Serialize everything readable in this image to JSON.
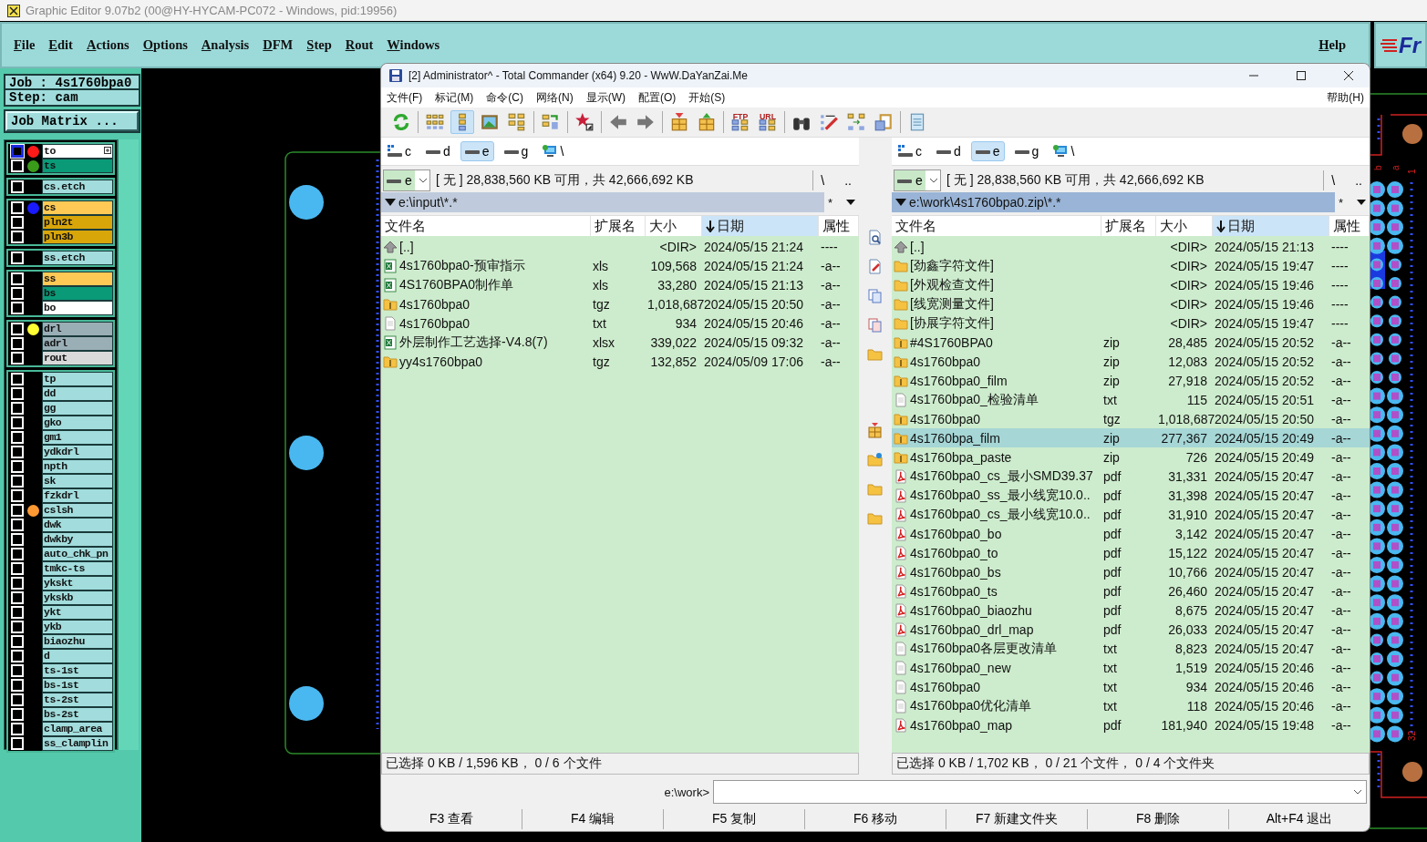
{
  "editor": {
    "title": "Graphic Editor 9.07b2 (00@HY-HYCAM-PC072 - Windows, pid:19956)",
    "menu": [
      "File",
      "Edit",
      "Actions",
      "Options",
      "Analysis",
      "DFM",
      "Step",
      "Rout",
      "Windows"
    ],
    "help": "Help",
    "logo_text": "Fr",
    "job": "Job : 4s1760bpa0",
    "step": "Step: cam",
    "job_matrix": "Job Matrix ...",
    "layer_groups": [
      {
        "layers": [
          {
            "name": "to",
            "color": "#ffffff",
            "marker": {
              "color": "#ff1a1a"
            },
            "selected": true
          },
          {
            "name": "ts",
            "color": "#0a9a78",
            "marker": {
              "color": "#3a9a1a"
            },
            "selected": false
          }
        ]
      },
      {
        "layers": [
          {
            "name": "cs.etch",
            "color": "#a2dcdc",
            "selected": false
          }
        ]
      },
      {
        "layers": [
          {
            "name": "cs",
            "color": "#ffc955",
            "marker": {
              "color": "#1a1aff"
            },
            "selected": false
          },
          {
            "name": "pln2t",
            "color": "#d9a60a",
            "selected": false
          },
          {
            "name": "pln3b",
            "color": "#d9a60a",
            "selected": false
          }
        ]
      },
      {
        "layers": [
          {
            "name": "ss.etch",
            "color": "#a2dcdc",
            "selected": false
          }
        ]
      },
      {
        "layers": [
          {
            "name": "ss",
            "color": "#ffc955",
            "selected": false
          },
          {
            "name": "bs",
            "color": "#0a9a78",
            "selected": false
          },
          {
            "name": "bo",
            "color": "#ffffff",
            "selected": false
          }
        ]
      },
      {
        "layers": [
          {
            "name": "drl",
            "color": "#9aaeb6",
            "marker": {
              "color": "#ffff33"
            },
            "selected": false
          },
          {
            "name": "adrl",
            "color": "#9aaeb6",
            "selected": false
          },
          {
            "name": "rout",
            "color": "#d9d9d9",
            "selected": false
          }
        ]
      },
      {
        "layers": [
          {
            "name": "tp",
            "color": "#a2dcdc",
            "selected": false
          },
          {
            "name": "dd",
            "color": "#a2dcdc",
            "selected": false
          },
          {
            "name": "gg",
            "color": "#a2dcdc",
            "selected": false
          },
          {
            "name": "gko",
            "color": "#a2dcdc",
            "selected": false
          },
          {
            "name": "gm1",
            "color": "#a2dcdc",
            "selected": false
          },
          {
            "name": "ydkdrl",
            "color": "#a2dcdc",
            "selected": false
          },
          {
            "name": "npth",
            "color": "#a2dcdc",
            "selected": false
          },
          {
            "name": "sk",
            "color": "#a2dcdc",
            "selected": false
          },
          {
            "name": "fzkdrl",
            "color": "#a2dcdc",
            "selected": false
          },
          {
            "name": "cslsh",
            "color": "#a2dcdc",
            "marker": {
              "color": "#ff9933"
            },
            "selected": false
          },
          {
            "name": "dwk",
            "color": "#a2dcdc",
            "selected": false
          },
          {
            "name": "dwkby",
            "color": "#a2dcdc",
            "selected": false
          },
          {
            "name": "auto_chk_pn",
            "color": "#a2dcdc",
            "selected": false
          },
          {
            "name": "tmkc-ts",
            "color": "#a2dcdc",
            "selected": false
          },
          {
            "name": "ykskt",
            "color": "#a2dcdc",
            "selected": false
          },
          {
            "name": "ykskb",
            "color": "#a2dcdc",
            "selected": false
          },
          {
            "name": "ykt",
            "color": "#a2dcdc",
            "selected": false
          },
          {
            "name": "ykb",
            "color": "#a2dcdc",
            "selected": false
          },
          {
            "name": "biaozhu",
            "color": "#a2dcdc",
            "selected": false
          },
          {
            "name": "d",
            "color": "#a2dcdc",
            "selected": false
          },
          {
            "name": "ts-1st",
            "color": "#a2dcdc",
            "selected": false
          },
          {
            "name": "bs-1st",
            "color": "#a2dcdc",
            "selected": false
          },
          {
            "name": "ts-2st",
            "color": "#a2dcdc",
            "selected": false
          },
          {
            "name": "bs-2st",
            "color": "#a2dcdc",
            "selected": false
          },
          {
            "name": "clamp_area",
            "color": "#a2dcdc",
            "selected": false
          },
          {
            "name": "ss_clamplin",
            "color": "#a2dcdc",
            "selected": false
          }
        ]
      }
    ],
    "pin_labels": [
      "b",
      "a",
      "1",
      "32"
    ]
  },
  "commander": {
    "title": "[2] Administrator^ - Total Commander (x64) 9.20 - WwW.DaYanZai.Me",
    "menu": [
      "文件(F)",
      "标记(M)",
      "命令(C)",
      "网络(N)",
      "显示(W)",
      "配置(O)",
      "开始(S)"
    ],
    "help": "帮助(H)",
    "toolbar": [
      [
        {
          "kind": "refresh",
          "selected": false
        }
      ],
      [
        {
          "kind": "brief",
          "selected": false
        },
        {
          "kind": "tree",
          "selected": true
        },
        {
          "kind": "thumbs",
          "selected": false
        },
        {
          "kind": "branch",
          "selected": false
        }
      ],
      [
        {
          "kind": "compare",
          "selected": false
        }
      ],
      [
        {
          "kind": "star",
          "selected": false
        }
      ],
      [
        {
          "kind": "back",
          "selected": false
        },
        {
          "kind": "forward",
          "selected": false
        }
      ],
      [
        {
          "kind": "pack",
          "selected": false
        },
        {
          "kind": "unpack",
          "selected": false
        }
      ],
      [
        {
          "kind": "ftp",
          "label": "FTP",
          "selected": false
        },
        {
          "kind": "url",
          "label": "URL",
          "selected": false
        }
      ],
      [
        {
          "kind": "find",
          "selected": false
        },
        {
          "kind": "rename",
          "selected": false
        },
        {
          "kind": "sync",
          "selected": false
        },
        {
          "kind": "copynames",
          "selected": false
        }
      ],
      [
        {
          "kind": "notepad",
          "selected": false
        }
      ]
    ],
    "panels": [
      {
        "active": false,
        "drives": [
          {
            "label": "c",
            "kind": "system",
            "selected": false
          },
          {
            "label": "d",
            "kind": "disk",
            "selected": false
          },
          {
            "label": "e",
            "kind": "disk",
            "selected": true
          },
          {
            "label": "g",
            "kind": "disk",
            "selected": false
          },
          {
            "label": "\\",
            "kind": "network",
            "selected": false
          }
        ],
        "drive_combo": "e",
        "free_space": "[ 无 ]  28,838,560 KB 可用，共 42,666,692 KB",
        "root": "\\",
        "parent": "..",
        "path": "e:\\input\\*.*",
        "filter": "*",
        "columns": [
          {
            "label": "文件名",
            "sorted": false
          },
          {
            "label": "扩展名",
            "sorted": false
          },
          {
            "label": "大小",
            "sorted": false
          },
          {
            "label": "日期",
            "sorted": true
          },
          {
            "label": "属性",
            "sorted": false
          }
        ],
        "rows": [
          {
            "kind": "up",
            "name": "[..]",
            "size": "<DIR>",
            "date": "2024/05/15 21:24",
            "attr": "----",
            "selected": false
          },
          {
            "kind": "sheet",
            "name": "4s1760bpa0-预审指示",
            "ext": "xls",
            "size": "109,568",
            "date": "2024/05/15 21:24",
            "attr": "-a--",
            "selected": false
          },
          {
            "kind": "sheet",
            "name": "4S1760BPA0制作单",
            "ext": "xls",
            "size": "33,280",
            "date": "2024/05/15 21:13",
            "attr": "-a--",
            "selected": false
          },
          {
            "kind": "archive",
            "name": "4s1760bpa0",
            "ext": "tgz",
            "size": "1,018,687",
            "date": "2024/05/15 20:50",
            "attr": "-a--",
            "selected": false
          },
          {
            "kind": "text",
            "name": "4s1760bpa0",
            "ext": "txt",
            "size": "934",
            "date": "2024/05/15 20:46",
            "attr": "-a--",
            "selected": false
          },
          {
            "kind": "sheet",
            "name": "外层制作工艺选择-V4.8(7)",
            "ext": "xlsx",
            "size": "339,022",
            "date": "2024/05/15 09:32",
            "attr": "-a--",
            "selected": false
          },
          {
            "kind": "archive",
            "name": "yy4s1760bpa0",
            "ext": "tgz",
            "size": "132,852",
            "date": "2024/05/09 17:06",
            "attr": "-a--",
            "selected": false
          }
        ],
        "status": "已选择 0 KB / 1,596 KB， 0 / 6 个文件"
      },
      {
        "active": true,
        "drives": [
          {
            "label": "c",
            "kind": "system",
            "selected": false
          },
          {
            "label": "d",
            "kind": "disk",
            "selected": false
          },
          {
            "label": "e",
            "kind": "disk",
            "selected": true
          },
          {
            "label": "g",
            "kind": "disk",
            "selected": false
          },
          {
            "label": "\\",
            "kind": "network",
            "selected": false
          }
        ],
        "drive_combo": "e",
        "free_space": "[ 无 ]  28,838,560 KB 可用，共 42,666,692 KB",
        "root": "\\",
        "parent": "..",
        "path": "e:\\work\\4s1760bpa0.zip\\*.*",
        "filter": "*",
        "columns": [
          {
            "label": "文件名",
            "sorted": false
          },
          {
            "label": "扩展名",
            "sorted": false
          },
          {
            "label": "大小",
            "sorted": false
          },
          {
            "label": "日期",
            "sorted": true
          },
          {
            "label": "属性",
            "sorted": false
          }
        ],
        "rows": [
          {
            "kind": "up",
            "name": "[..]",
            "size": "<DIR>",
            "date": "2024/05/15 21:13",
            "attr": "----",
            "selected": false
          },
          {
            "kind": "folder",
            "name": "[劲鑫字符文件]",
            "size": "<DIR>",
            "date": "2024/05/15 19:47",
            "attr": "----",
            "selected": false
          },
          {
            "kind": "folder",
            "name": "[外观检查文件]",
            "size": "<DIR>",
            "date": "2024/05/15 19:46",
            "attr": "----",
            "selected": false
          },
          {
            "kind": "folder",
            "name": "[线宽测量文件]",
            "size": "<DIR>",
            "date": "2024/05/15 19:46",
            "attr": "----",
            "selected": false
          },
          {
            "kind": "folder",
            "name": "[协展字符文件]",
            "size": "<DIR>",
            "date": "2024/05/15 19:47",
            "attr": "----",
            "selected": false
          },
          {
            "kind": "archive",
            "name": "#4S1760BPA0",
            "ext": "zip",
            "size": "28,485",
            "date": "2024/05/15 20:52",
            "attr": "-a--",
            "selected": false
          },
          {
            "kind": "archive",
            "name": "4s1760bpa0",
            "ext": "zip",
            "size": "12,083",
            "date": "2024/05/15 20:52",
            "attr": "-a--",
            "selected": false
          },
          {
            "kind": "archive",
            "name": "4s1760bpa0_film",
            "ext": "zip",
            "size": "27,918",
            "date": "2024/05/15 20:52",
            "attr": "-a--",
            "selected": false
          },
          {
            "kind": "text",
            "name": "4s1760bpa0_检验清单",
            "ext": "txt",
            "size": "115",
            "date": "2024/05/15 20:51",
            "attr": "-a--",
            "selected": false
          },
          {
            "kind": "archive",
            "name": "4s1760bpa0",
            "ext": "tgz",
            "size": "1,018,687",
            "date": "2024/05/15 20:50",
            "attr": "-a--",
            "selected": false
          },
          {
            "kind": "archive",
            "name": "4s1760bpa_film",
            "ext": "zip",
            "size": "277,367",
            "date": "2024/05/15 20:49",
            "attr": "-a--",
            "selected": true
          },
          {
            "kind": "archive",
            "name": "4s1760bpa_paste",
            "ext": "zip",
            "size": "726",
            "date": "2024/05/15 20:49",
            "attr": "-a--",
            "selected": false
          },
          {
            "kind": "pdf",
            "name": "4s1760bpa0_cs_最小SMD39.37",
            "ext": "pdf",
            "size": "31,331",
            "date": "2024/05/15 20:47",
            "attr": "-a--",
            "selected": false
          },
          {
            "kind": "pdf",
            "name": "4s1760bpa0_ss_最小线宽10.0..",
            "ext": "pdf",
            "size": "31,398",
            "date": "2024/05/15 20:47",
            "attr": "-a--",
            "selected": false
          },
          {
            "kind": "pdf",
            "name": "4s1760bpa0_cs_最小线宽10.0..",
            "ext": "pdf",
            "size": "31,910",
            "date": "2024/05/15 20:47",
            "attr": "-a--",
            "selected": false
          },
          {
            "kind": "pdf",
            "name": "4s1760bpa0_bo",
            "ext": "pdf",
            "size": "3,142",
            "date": "2024/05/15 20:47",
            "attr": "-a--",
            "selected": false
          },
          {
            "kind": "pdf",
            "name": "4s1760bpa0_to",
            "ext": "pdf",
            "size": "15,122",
            "date": "2024/05/15 20:47",
            "attr": "-a--",
            "selected": false
          },
          {
            "kind": "pdf",
            "name": "4s1760bpa0_bs",
            "ext": "pdf",
            "size": "10,766",
            "date": "2024/05/15 20:47",
            "attr": "-a--",
            "selected": false
          },
          {
            "kind": "pdf",
            "name": "4s1760bpa0_ts",
            "ext": "pdf",
            "size": "26,460",
            "date": "2024/05/15 20:47",
            "attr": "-a--",
            "selected": false
          },
          {
            "kind": "pdf",
            "name": "4s1760bpa0_biaozhu",
            "ext": "pdf",
            "size": "8,675",
            "date": "2024/05/15 20:47",
            "attr": "-a--",
            "selected": false
          },
          {
            "kind": "pdf",
            "name": "4s1760bpa0_drl_map",
            "ext": "pdf",
            "size": "26,033",
            "date": "2024/05/15 20:47",
            "attr": "-a--",
            "selected": false
          },
          {
            "kind": "text",
            "name": "4s1760bpa0各层更改清单",
            "ext": "txt",
            "size": "8,823",
            "date": "2024/05/15 20:47",
            "attr": "-a--",
            "selected": false
          },
          {
            "kind": "text",
            "name": "4s1760bpa0_new",
            "ext": "txt",
            "size": "1,519",
            "date": "2024/05/15 20:46",
            "attr": "-a--",
            "selected": false
          },
          {
            "kind": "text",
            "name": "4s1760bpa0",
            "ext": "txt",
            "size": "934",
            "date": "2024/05/15 20:46",
            "attr": "-a--",
            "selected": false
          },
          {
            "kind": "text",
            "name": "4s1760bpa0优化清单",
            "ext": "txt",
            "size": "118",
            "date": "2024/05/15 20:46",
            "attr": "-a--",
            "selected": false
          },
          {
            "kind": "pdf",
            "name": "4s1760bpa0_map",
            "ext": "pdf",
            "size": "181,940",
            "date": "2024/05/15 19:48",
            "attr": "-a--",
            "selected": false
          }
        ],
        "status": "已选择 0 KB / 1,702 KB， 0 / 21 个文件， 0 / 4 个文件夹"
      }
    ],
    "command_prompt": "e:\\work>",
    "function_keys": [
      "F3 查看",
      "F4 编辑",
      "F5 复制",
      "F6 移动",
      "F7 新建文件夹",
      "F8 删除",
      "Alt+F4 退出"
    ]
  }
}
